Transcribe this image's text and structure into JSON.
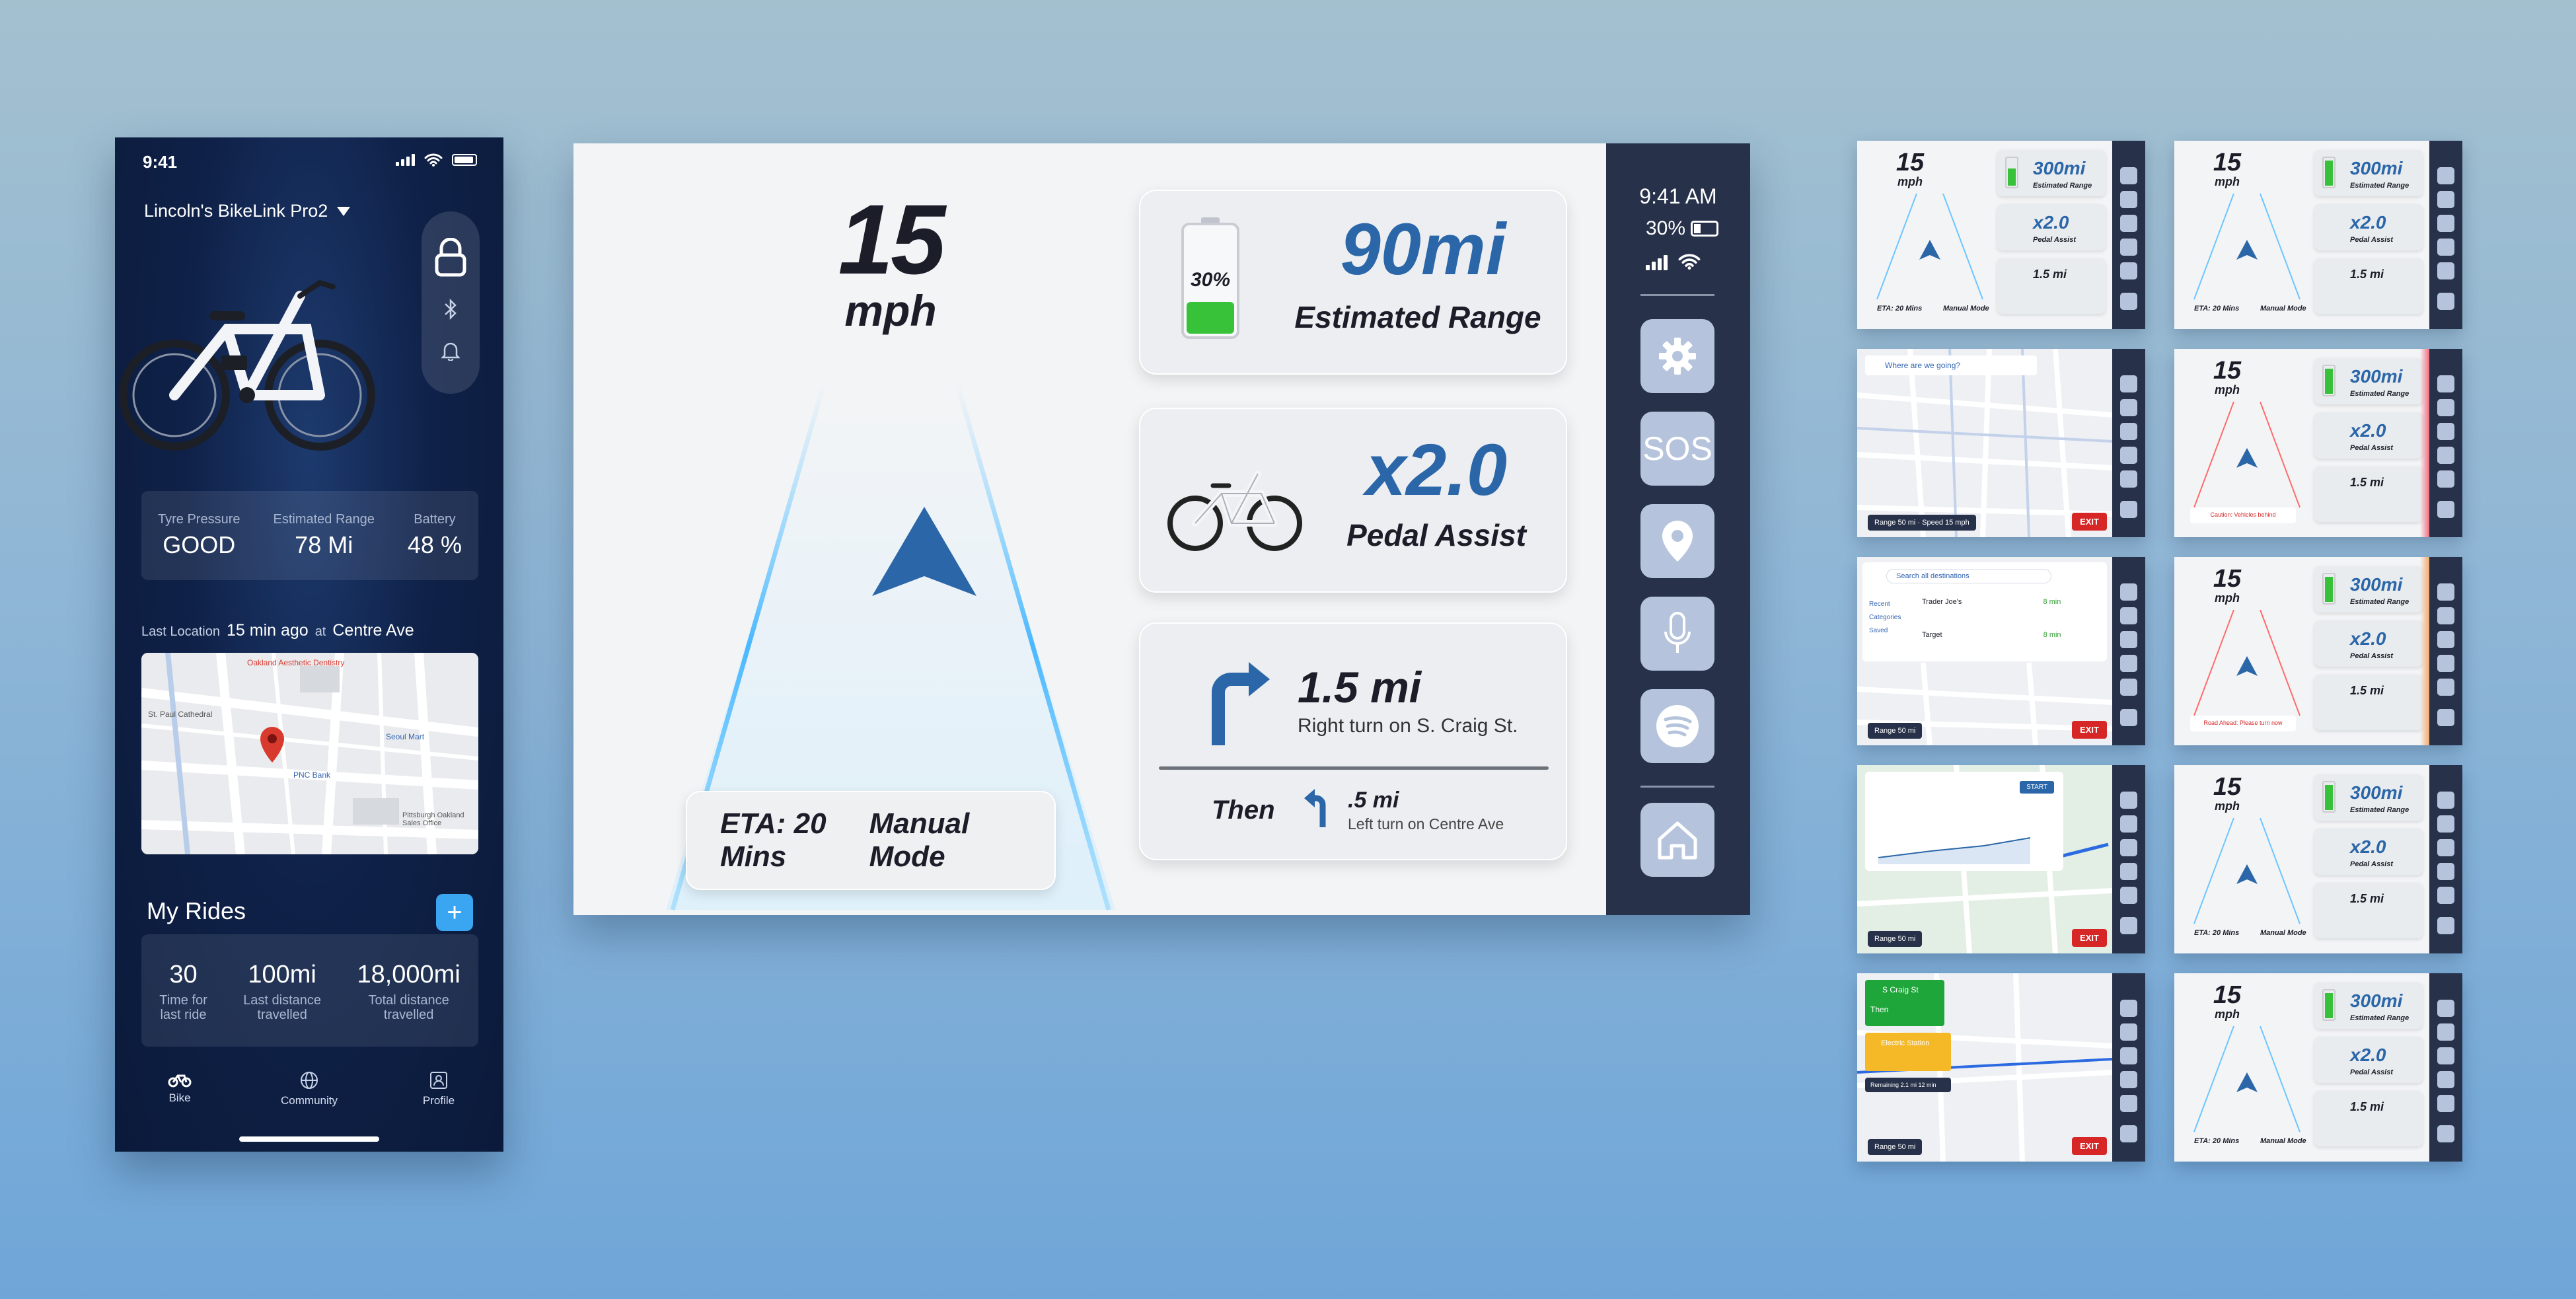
{
  "phone": {
    "status_time": "9:41",
    "bike_name": "Lincoln's BikeLink Pro2",
    "stats": [
      {
        "label": "Tyre Pressure",
        "value": "GOOD"
      },
      {
        "label": "Estimated Range",
        "value": "78 Mi"
      },
      {
        "label": "Battery",
        "value": "48 %"
      }
    ],
    "last_location": {
      "prefix": "Last Location",
      "time": "15 min ago",
      "at": "at",
      "place": "Centre Ave"
    },
    "map_labels": [
      "Oakland Aesthetic Dentistry",
      "St. Paul Cathedral",
      "Seoul Mart",
      "PNC Bank",
      "Pittsburgh Oakland Sales Office"
    ],
    "rides": {
      "title": "My Rides",
      "add_label": "+",
      "items": [
        {
          "value": "30",
          "label_line1": "Time for",
          "label_line2": "last ride"
        },
        {
          "value": "100mi",
          "label_line1": "Last distance",
          "label_line2": "travelled"
        },
        {
          "value": "18,000mi",
          "label_line1": "Total distance",
          "label_line2": "travelled"
        }
      ]
    },
    "tabs": [
      {
        "label": "Bike",
        "icon": "bike-icon"
      },
      {
        "label": "Community",
        "icon": "globe-icon"
      },
      {
        "label": "Profile",
        "icon": "profile-icon"
      }
    ]
  },
  "dash": {
    "speed_value": "15",
    "speed_unit": "mph",
    "eta": "ETA: 20 Mins",
    "mode": "Manual Mode",
    "battery_percent_label": "30%",
    "battery_level": 0.3,
    "range_value": "90mi",
    "range_label": "Estimated Range",
    "assist_value": "x2.0",
    "assist_label": "Pedal Assist",
    "nav_distance": "1.5 mi",
    "nav_instruction": "Right turn on S. Craig St.",
    "then_label": "Then",
    "next_distance": ".5 mi",
    "next_instruction": "Left turn on Centre Ave",
    "sidebar": {
      "time": "9:41 AM",
      "battery": "30%",
      "sos_label": "SOS",
      "buttons": [
        "gear-icon",
        "sos",
        "location-pin-icon",
        "microphone-icon",
        "spotify-icon",
        "home-icon"
      ]
    },
    "colors": {
      "accent": "#2a66a8",
      "sidebar": "#27324a",
      "button": "#b5c4dc",
      "battery_green": "#37c23a"
    }
  },
  "thumbs": {
    "speed_value": "15",
    "speed_unit": "mph",
    "range_value": "300mi",
    "range_label": "Estimated Range",
    "assist_value": "x2.0",
    "assist_label": "Pedal Assist",
    "nav_distance": "1.5 mi",
    "eta": "ETA: 20 Mins",
    "mode": "Manual Mode",
    "search_placeholder": "Where are we going?",
    "search_all": "Search all destinations",
    "exit_label": "EXIT",
    "range_pill": "Range 50 mi",
    "speed_pill": "Speed 15 mph",
    "caution_text": "Caution: Vehicles behind",
    "road_alert_text": "Road Ahead: Please turn now",
    "dest_list": [
      {
        "name": "Trader Joe's",
        "eta": "8 min"
      },
      {
        "name": "Target",
        "eta": "8 min"
      }
    ],
    "dest_categories": [
      "Recent",
      "Categories",
      "Saved"
    ],
    "elevation_start_label": "START",
    "green_card_title": "S Craig St",
    "then_label": "Then",
    "station_label": "Electric Station",
    "remaining_label": "Remaining 2.1 mi 12 min"
  }
}
